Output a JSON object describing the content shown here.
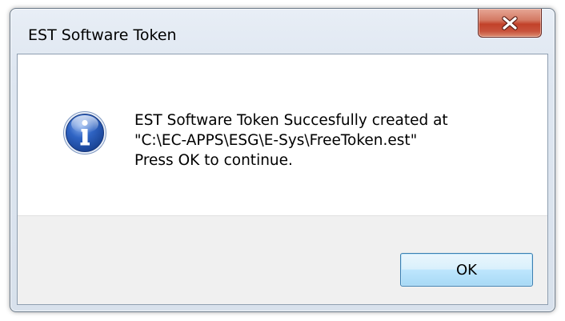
{
  "window": {
    "title": "EST Software Token"
  },
  "titlebar": {
    "close_icon": "close-x-icon"
  },
  "message": {
    "icon": "information-icon",
    "lines": [
      "EST Software Token Succesfully created at",
      "\"C:\\EC-APPS\\ESG\\E-Sys\\FreeToken.est\"",
      "Press OK to continue."
    ]
  },
  "buttons": {
    "ok_label": "OK"
  },
  "colors": {
    "close_button": "#c8533c",
    "info_icon": "#1c4fa6",
    "ok_button_border": "#3c7fb1",
    "button_bar": "#f0f0f0"
  }
}
